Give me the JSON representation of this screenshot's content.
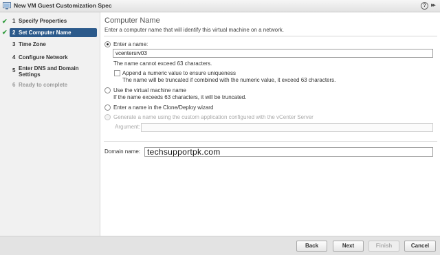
{
  "window": {
    "title": "New VM Guest Customization Spec",
    "help_glyph": "?",
    "expand_glyph": "▸▸"
  },
  "sidebar": {
    "steps": [
      {
        "num": "1",
        "label": "Specify Properties",
        "state": "done"
      },
      {
        "num": "2",
        "label": "Set Computer Name",
        "state": "active"
      },
      {
        "num": "3",
        "label": "Time Zone",
        "state": "pending"
      },
      {
        "num": "4",
        "label": "Configure Network",
        "state": "pending"
      },
      {
        "num": "5",
        "label": "Enter DNS and Domain Settings",
        "state": "pending"
      },
      {
        "num": "6",
        "label": "Ready to complete",
        "state": "disabled"
      }
    ],
    "check_glyph": "✔"
  },
  "main": {
    "title": "Computer Name",
    "description": "Enter a computer name that will identify this virtual machine on a network.",
    "option_enter_name": {
      "label": "Enter a name:",
      "value": "vcentersrv03",
      "hint": "The name cannot exceed 63 characters.",
      "append_label": "Append a numeric value to ensure uniqueness",
      "append_hint": "The name will be truncated if combined with the numeric value, it exceed 63 characters."
    },
    "option_vm_name": {
      "label": "Use the virtual machine name",
      "hint": "If the name exceeds 63 characters, it will be truncated."
    },
    "option_wizard": {
      "label": "Enter a name in the Clone/Deploy wizard"
    },
    "option_custom_app": {
      "label": "Generate a name using the custom application configured with the vCenter Server",
      "argument_label": "Argument:"
    },
    "domain": {
      "label": "Domain name:",
      "value": "techsupportpk.com"
    }
  },
  "footer": {
    "back": "Back",
    "next": "Next",
    "finish": "Finish",
    "cancel": "Cancel"
  }
}
